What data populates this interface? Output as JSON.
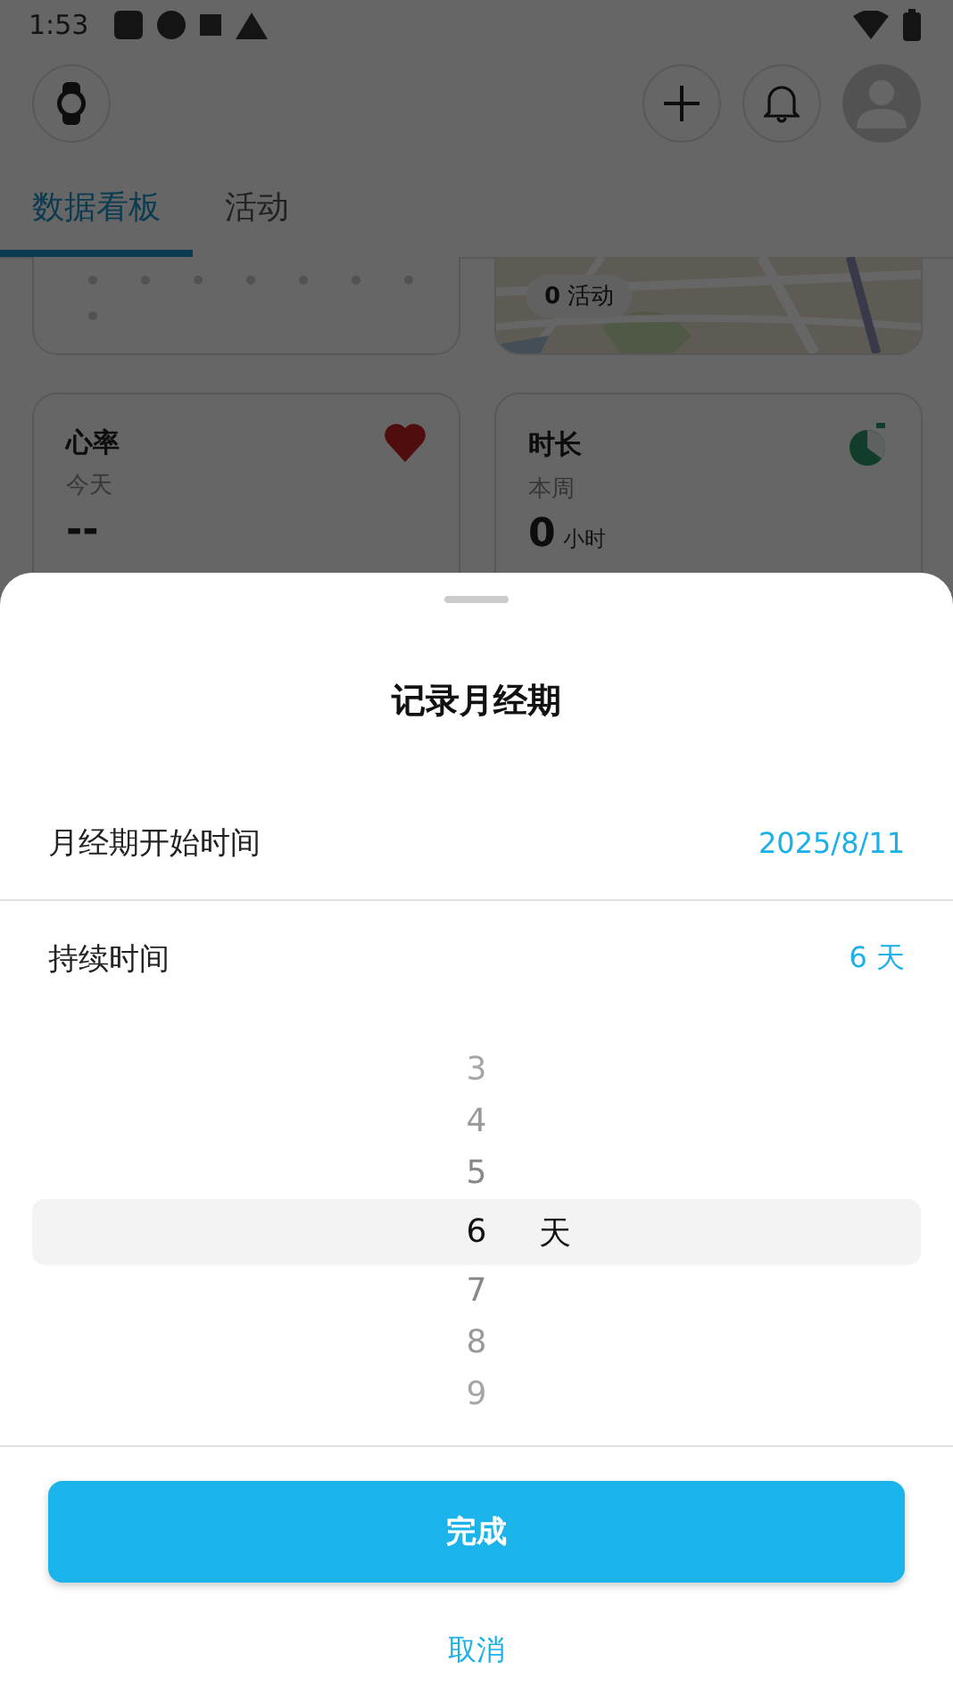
{
  "status_bar": {
    "time": "1:53"
  },
  "tabs": [
    {
      "label": "数据看板",
      "selected": true
    },
    {
      "label": "活动",
      "selected": false
    }
  ],
  "map_card": {
    "badge": "**0** 活动"
  },
  "cards": [
    {
      "kind": "heart",
      "title": "心率",
      "period": "今天",
      "value": "--"
    },
    {
      "kind": "timer",
      "title": "时长",
      "period": "本周",
      "value": "0",
      "unit": "小时"
    }
  ],
  "sheet": {
    "title": "记录月经期",
    "rows": [
      {
        "label": "月经期开始时间",
        "value": "2025/8/11"
      },
      {
        "label": "持续时间",
        "value": "6 天"
      }
    ],
    "picker": {
      "unit": "天",
      "options": [
        {
          "label": "3",
          "selected": false
        },
        {
          "label": "4",
          "selected": false
        },
        {
          "label": "5",
          "selected": false
        },
        {
          "label": "6",
          "selected": true
        },
        {
          "label": "7",
          "selected": false
        },
        {
          "label": "8",
          "selected": false
        },
        {
          "label": "9",
          "selected": false
        }
      ]
    },
    "confirm": "完成",
    "cancel": "取消"
  }
}
